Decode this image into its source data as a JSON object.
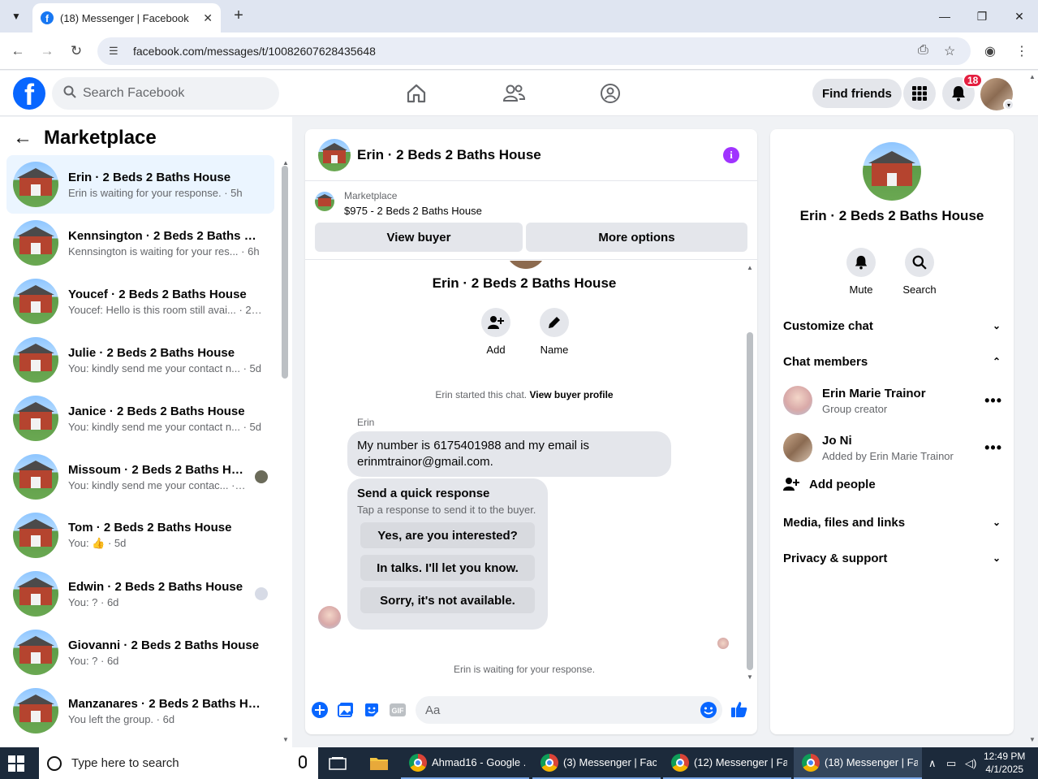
{
  "browser": {
    "tab_title": "(18) Messenger | Facebook",
    "favicon": "f",
    "url": "facebook.com/messages/t/10082607628435648"
  },
  "header": {
    "search_placeholder": "Search Facebook",
    "find_friends": "Find friends",
    "notification_count": "18",
    "logo": "f"
  },
  "sidebar": {
    "title": "Marketplace",
    "conversations": [
      {
        "name": "Erin · 2 Beds 2 Baths House",
        "preview": "Erin is waiting for your response. · 5h"
      },
      {
        "name": "Kennsington · 2 Beds 2 Baths Ho...",
        "preview": "Kennsington is waiting for your res... · 6h"
      },
      {
        "name": "Youcef · 2 Beds 2 Baths House",
        "preview": "Youcef: Hello is this room still avai... · 21h"
      },
      {
        "name": "Julie · 2 Beds 2 Baths House",
        "preview": "You: kindly send me your contact n... · 5d"
      },
      {
        "name": "Janice · 2 Beds 2 Baths House",
        "preview": "You: kindly send me your contact n... · 5d"
      },
      {
        "name": "Missoum · 2 Beds 2 Baths Ho...",
        "preview": "You: kindly send me your contac... · 5d"
      },
      {
        "name": "Tom · 2 Beds 2 Baths House",
        "preview": "You: 👍 · 5d"
      },
      {
        "name": "Edwin · 2 Beds 2 Baths House",
        "preview": "You: ? · 6d"
      },
      {
        "name": "Giovanni · 2 Beds 2 Baths House",
        "preview": "You: ? · 6d"
      },
      {
        "name": "Manzanares · 2 Beds 2 Baths Ho...",
        "preview": "You left the group. · 6d"
      }
    ]
  },
  "chat": {
    "title": "Erin · 2 Beds 2 Baths House",
    "marketplace_label": "Marketplace",
    "listing": "$975 - 2 Beds 2 Baths House",
    "view_buyer": "View buyer",
    "more_options": "More options",
    "group_title": "Erin · 2 Beds 2 Baths House",
    "add_label": "Add",
    "name_label": "Name",
    "started_text": "Erin started this chat.",
    "view_buyer_profile": "View buyer profile",
    "sender": "Erin",
    "message": "My number is 6175401988 and my email is erinmtrainor@gmail.com.",
    "quick_title": "Send a quick response",
    "quick_subtitle": "Tap a response to send it to the buyer.",
    "quick_replies": [
      "Yes, are you interested?",
      "In talks. I'll let you know.",
      "Sorry, it's not available."
    ],
    "waiting": "Erin is waiting for your response.",
    "composer_placeholder": "Aa"
  },
  "panel": {
    "title": "Erin · 2 Beds 2 Baths House",
    "mute": "Mute",
    "search": "Search",
    "customize": "Customize chat",
    "members_heading": "Chat members",
    "members": [
      {
        "name": "Erin Marie Trainor",
        "role": "Group creator"
      },
      {
        "name": "Jo Ni",
        "role": "Added by Erin Marie Trainor"
      }
    ],
    "add_people": "Add people",
    "media": "Media, files and links",
    "privacy": "Privacy & support"
  },
  "taskbar": {
    "search_placeholder": "Type here to search",
    "apps": [
      "Ahmad16 - Google ...",
      "(3) Messenger | Fac...",
      "(12) Messenger | Fa...",
      "(18) Messenger | Fa..."
    ],
    "time": "12:49 PM",
    "date": "4/1/2025"
  },
  "colors": {
    "fb_blue": "#0866ff",
    "active_row": "#ebf5ff",
    "info_purple": "#a033ff",
    "badge_red": "#e41e3f"
  }
}
